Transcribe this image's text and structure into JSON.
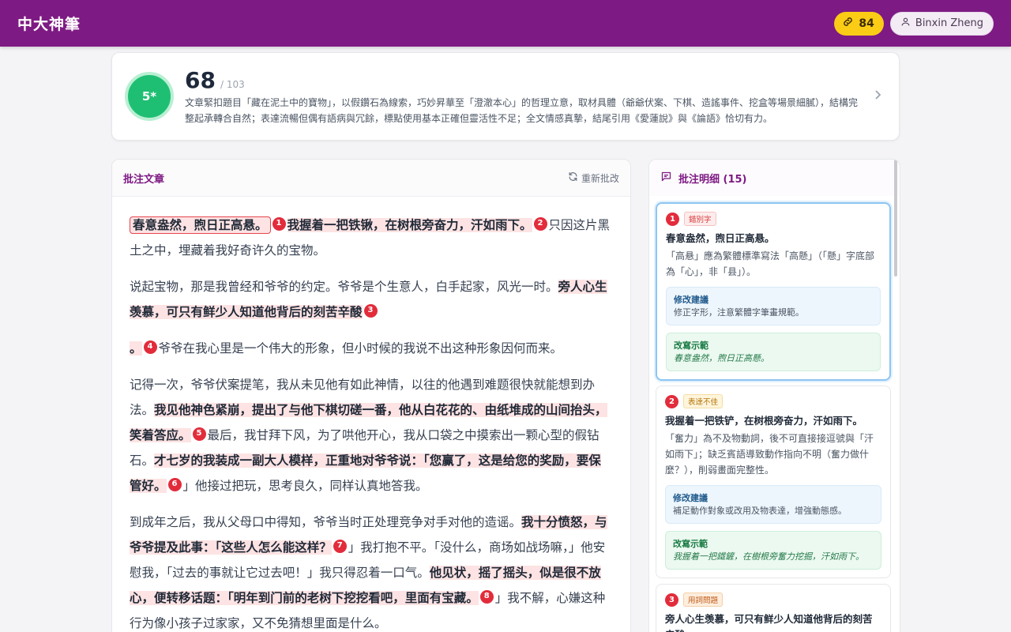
{
  "app": {
    "title": "中大神筆"
  },
  "topbar": {
    "credits": "84",
    "user_name": "Binxin Zheng"
  },
  "score_card": {
    "grade": "5*",
    "score": "68",
    "total": "/ 103",
    "summary": "文章緊扣題目「藏在泥土中的寶物」，以假鑽石為線索，巧妙昇華至「澄澈本心」的哲理立意，取材具體（爺爺伏案、下棋、造謠事件、挖盒等場景細膩），結構完整起承轉合自然；表達流暢但偶有語病與冗餘，標點使用基本正確但靈活性不足；全文情感真摯，結尾引用《愛蓮說》與《論語》恰切有力。"
  },
  "essay": {
    "title": "批注文章",
    "regrade_label": "重新批改",
    "p1": {
      "s1": "春意盎然，煦日正高悬。",
      "s2": "我握着一把铁锹，在树根旁奋力，汗如雨下。",
      "s3": "只因这片黑土之中，埋藏着我好奇许久的宝物。"
    },
    "p2": {
      "s1": "说起宝物，那是我曾经和爷爷的约定。爷爷是个生意人，白手起家，风光一时。",
      "s2": "旁人心生羡慕，可只有鲜少人知道他背后的刻苦辛酸"
    },
    "p3": {
      "s1": "。",
      "s2": "爷爷在我心里是一个伟大的形象，但小时候的我说不出这种形象因何而来。"
    },
    "p4": {
      "s1": "记得一次，爷爷伏案提笔，我从未见他有如此神情，以往的他遇到难题很快就能想到办法。",
      "s2": "我见他神色紧崩，提出了与他下棋切磋一番，他从白花花的、由纸堆成的山间抬头，笑着答应。",
      "s3": "最后，我甘拜下风，为了哄他开心，我从口袋之中摸索出一颗心型的假钻石。",
      "s4": "才七岁的我装成一副大人模样，正重地对爷爷说：「您赢了，这是给您的奖励，要保管好。",
      "s5": "」他接过把玩，思考良久，同样认真地答我。"
    },
    "p5": {
      "s1": "到成年之后，我从父母口中得知，爷爷当时正处理竞争对手对他的造谣。",
      "s2": "我十分愤怒，与爷爷提及此事：「这些人怎么能这样？",
      "s3": "」我打抱不平。「没什么，商场如战场嘛，」他安慰我，「过去的事就让它过去吧！」我只得忍着一口气。",
      "s4": "他见状，摇了摇头，似是很不放心，便转移话题：「明年到门前的老树下挖挖看吧，里面有宝藏。",
      "s5": "」我不解，心嫌这种行为像小孩子过家家，又不免猜想里面是什么。"
    },
    "markers": [
      "1",
      "2",
      "3",
      "4",
      "5",
      "6",
      "7",
      "8"
    ]
  },
  "notes": {
    "title": "批注明细 (15)",
    "items": [
      {
        "num": "1",
        "tag": "錯別字",
        "quote": "春意盎然，煦日正高悬。",
        "explain": "「高悬」應為繁體標準寫法「高懸」（「懸」字底部為「心」，非「县」）。",
        "suggest_label": "修改建議",
        "suggest": "修正字形，注意繁體字筆畫規範。",
        "example_label": "改寫示範",
        "example": "春意盎然，煦日正高懸。"
      },
      {
        "num": "2",
        "tag": "表達不佳",
        "quote": "我握着一把铁铲，在树根旁奋力，汗如雨下。",
        "explain": "「奮力」為不及物動詞，後不可直接接逗號與「汗如雨下」；缺乏賓語導致動作指向不明（奮力做什麼？），削弱畫面完整性。",
        "suggest_label": "修改建議",
        "suggest": "補足動作對象或改用及物表達，增強動態感。",
        "example_label": "改寫示範",
        "example": "我握着一把鐵鏟，在樹根旁奮力挖掘，汗如雨下。"
      },
      {
        "num": "3",
        "tag": "用詞問題",
        "quote": "旁人心生羡慕，可只有鲜少人知道他背后的刻苦辛酸"
      }
    ]
  },
  "colors": {
    "brand": "#7e1a83",
    "credits": "#facc15",
    "grade": "#1fbf73",
    "marker": "#e22c3b",
    "highlight": "#fde3e3"
  }
}
